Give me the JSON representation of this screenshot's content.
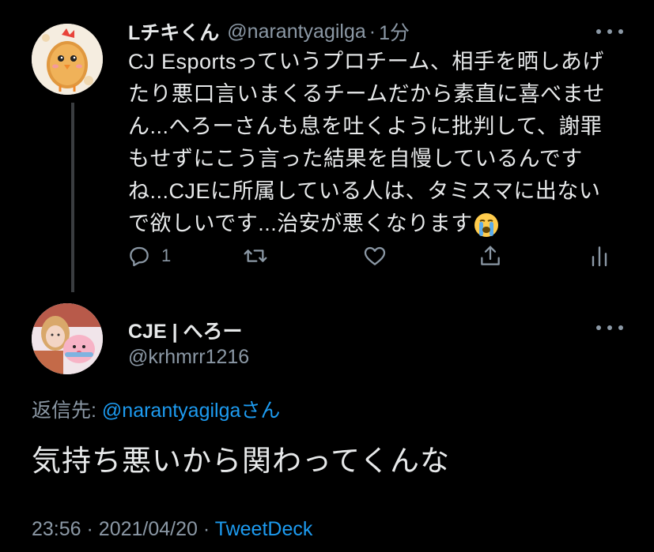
{
  "tweet1": {
    "display_name": "Lチキくん",
    "handle": "@narantyagilga",
    "separator": "·",
    "time": "1分",
    "text_lines": [
      "CJ Esportsっていうプロチーム、相手を晒しあげ",
      "たり悪口言いまくるチームだから素直に喜べませ",
      "ん...へろーさんも息を吐くように批判して、謝罪",
      "もせずにこう言った結果を自慢しているんです",
      "ね...CJEに所属している人は、タミスマに出ない",
      "で欲しいです...治安が悪くなります"
    ],
    "emoji": "loudly-crying-face",
    "reply_count": "1",
    "avatar": "fried-chicken-mascot-avatar"
  },
  "tweet2": {
    "display_name": "CJE | へろー",
    "handle": "@krhmrr1216",
    "reply_to_label": "返信先: ",
    "reply_to_mention": "@narantyagilga",
    "reply_to_suffix": "さん",
    "text": "気持ち悪いから関わってくんな",
    "time": "23:56",
    "separator": "·",
    "date": "2021/04/20",
    "source": "TweetDeck",
    "avatar": "person-with-plush-avatar"
  },
  "colors": {
    "background": "#000000",
    "text": "#e7e9ea",
    "secondary": "#8b98a5",
    "link": "#1d9bf0",
    "thread_line": "#3a3d40"
  }
}
